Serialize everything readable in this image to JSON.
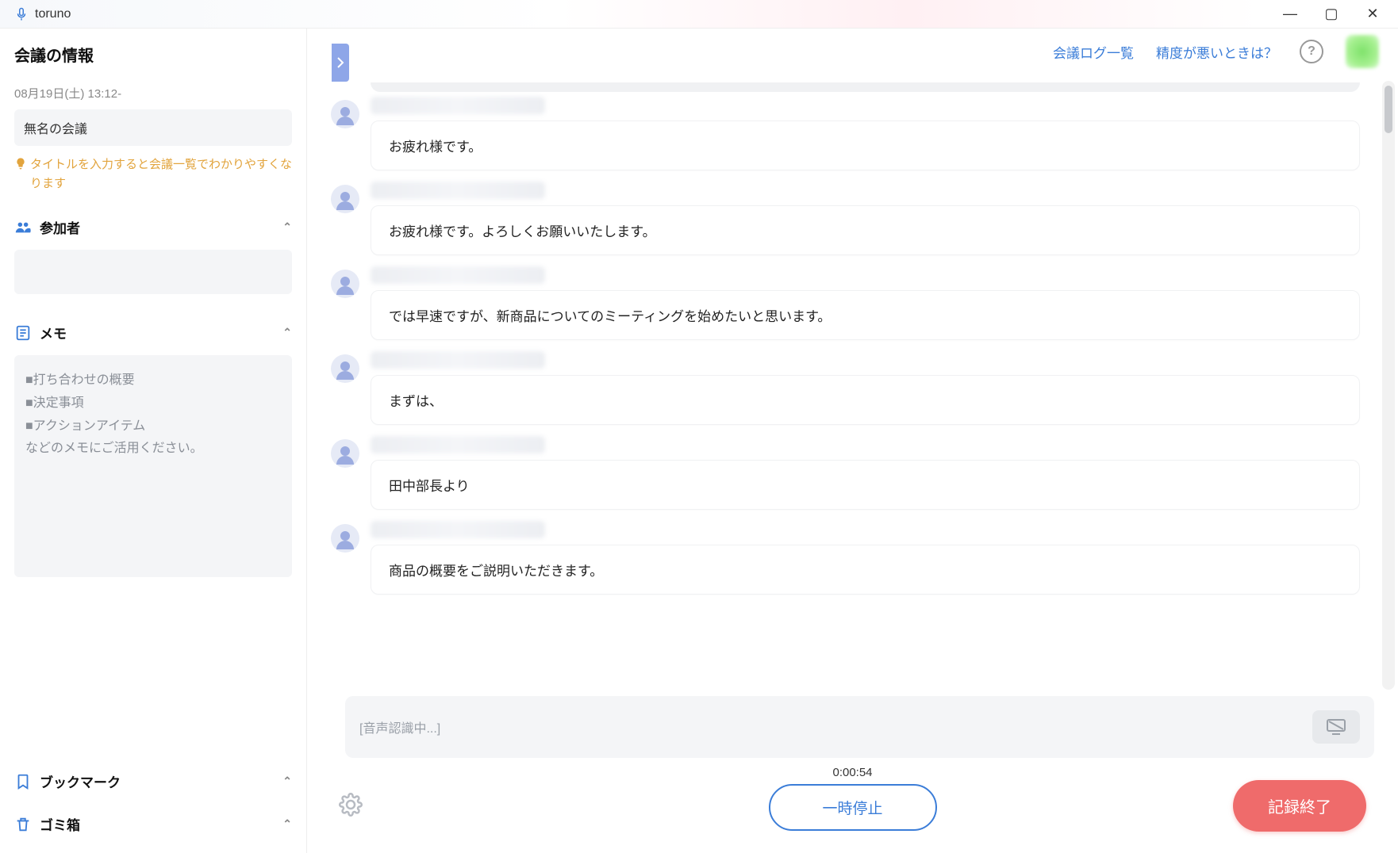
{
  "app": {
    "name": "toruno"
  },
  "window": {
    "minimize": "—",
    "maximize": "▢",
    "close": "✕"
  },
  "header": {
    "log_list": "会議ログ一覧",
    "accuracy_help": "精度が悪いときは？",
    "help_symbol": "?"
  },
  "sidebar": {
    "title": "会議の情報",
    "datetime": "08月19日(土) 13:12-",
    "meeting_title_value": "無名の会議",
    "title_hint": "タイトルを入力すると会議一覧でわかりやすくなります",
    "sections": {
      "participants": "参加者",
      "memo": "メモ",
      "bookmark": "ブックマーク",
      "trash": "ゴミ箱"
    },
    "memo_placeholder_lines": [
      "■打ち合わせの概要",
      "■決定事項",
      "■アクションアイテム",
      "などのメモにご活用ください。"
    ]
  },
  "transcript": [
    {
      "text": "お疲れ様です。"
    },
    {
      "text": "お疲れ様です。よろしくお願いいたします。"
    },
    {
      "text": "では早速ですが、新商品についてのミーティングを始めたいと思います。"
    },
    {
      "text": "まずは、"
    },
    {
      "text": "田中部長より"
    },
    {
      "text": "商品の概要をご説明いただきます。"
    }
  ],
  "input": {
    "recognizing_placeholder": "[音声認識中...]"
  },
  "controls": {
    "timer": "0:00:54",
    "pause": "一時停止",
    "stop": "記録終了"
  }
}
